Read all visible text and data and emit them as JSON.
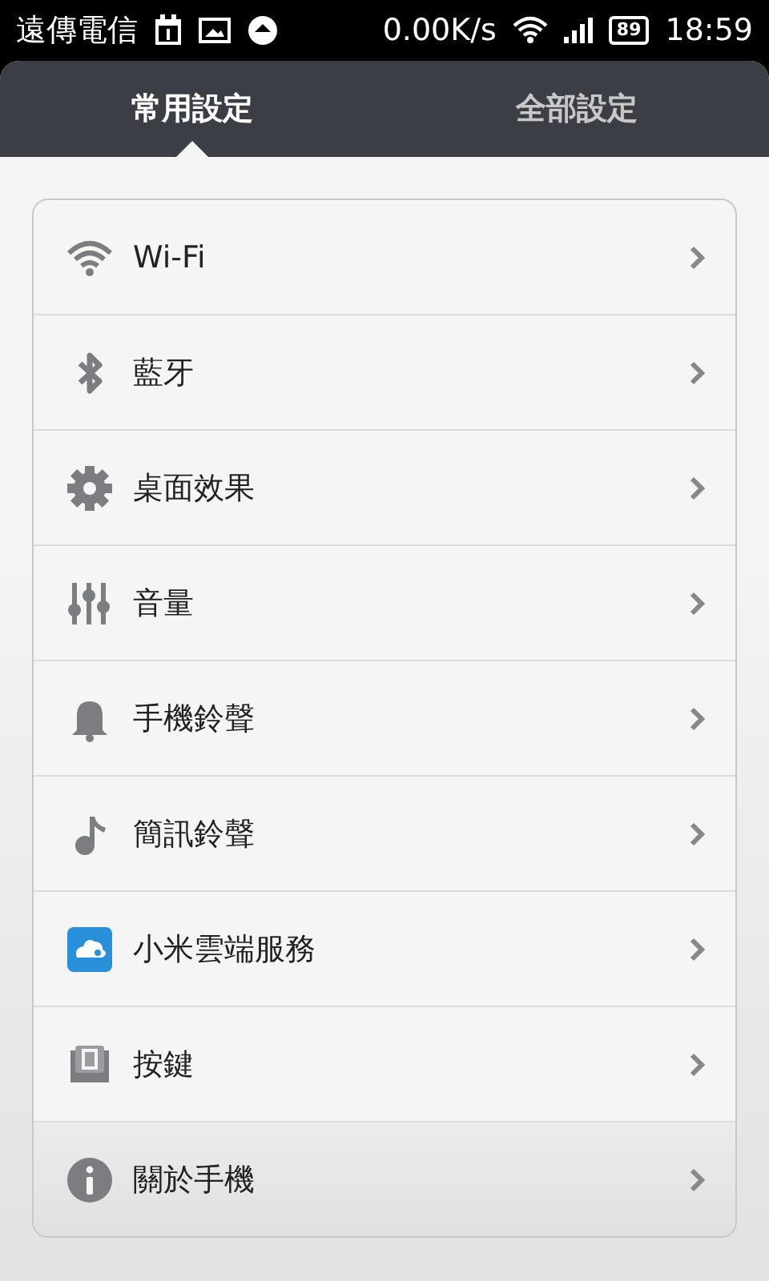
{
  "status_bar": {
    "carrier": "遠傳電信",
    "speed": "0.00K/s",
    "battery": "89",
    "time": "18:59"
  },
  "tabs": [
    {
      "label": "常用設定",
      "selected": true
    },
    {
      "label": "全部設定",
      "selected": false
    }
  ],
  "items": [
    {
      "kind": "wifi",
      "label": "Wi-Fi"
    },
    {
      "kind": "bluetooth",
      "label": "藍牙"
    },
    {
      "kind": "gear",
      "label": "桌面效果"
    },
    {
      "kind": "sliders",
      "label": "音量"
    },
    {
      "kind": "bell",
      "label": "手機鈴聲"
    },
    {
      "kind": "note",
      "label": "簡訊鈴聲"
    },
    {
      "kind": "cloud",
      "label": "小米雲端服務"
    },
    {
      "kind": "key",
      "label": "按鍵"
    },
    {
      "kind": "info",
      "label": "關於手機"
    }
  ]
}
